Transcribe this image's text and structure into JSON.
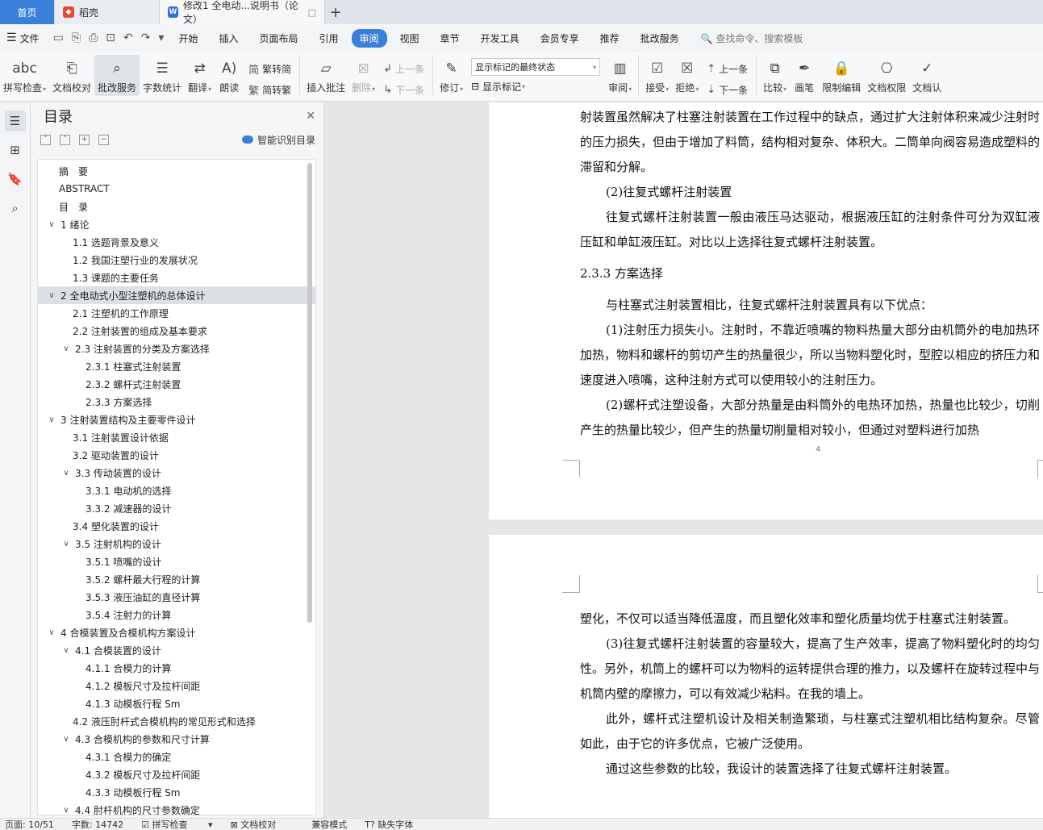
{
  "tabs": {
    "home": "首页",
    "daoke": "稻壳",
    "doc": "修改1 全电动...说明书（论文）"
  },
  "menu": {
    "file": "文件",
    "items": [
      "开始",
      "插入",
      "页面布局",
      "引用",
      "审阅",
      "视图",
      "章节",
      "开发工具",
      "会员专享",
      "推荐",
      "批改服务"
    ],
    "search": "查找命令、搜索模板"
  },
  "ribbon": {
    "spell": "拼写检查",
    "proof": "文档校对",
    "grading": "批改服务",
    "wordcount": "字数统计",
    "translate": "翻译",
    "read": "朗读",
    "trad": "繁转简",
    "simp": "简转繁",
    "insert_comment": "插入批注",
    "delete": "删除",
    "prev": "上一条",
    "next": "下一条",
    "revise": "修订",
    "markup_state": "显示标记的最终状态",
    "show_markup": "显示标记",
    "review": "审阅",
    "accept": "接受",
    "reject": "拒绝",
    "prev2": "上一条",
    "next2": "下一条",
    "compare": "比较",
    "pen": "画笔",
    "restrict": "限制编辑",
    "perm": "文档权限",
    "cert": "文档认"
  },
  "toc": {
    "title": "目录",
    "smart": "智能识别目录",
    "items": [
      {
        "text": "摘　要",
        "level": "lvl0",
        "chev": ""
      },
      {
        "text": "ABSTRACT",
        "level": "lvl0",
        "chev": ""
      },
      {
        "text": "目　录",
        "level": "lvl0",
        "chev": ""
      },
      {
        "text": "1  绪论",
        "level": "lvl1",
        "chev": "∨"
      },
      {
        "text": "1.1  选题背景及意义",
        "level": "lvl2",
        "chev": ""
      },
      {
        "text": "1.2  我国注塑行业的发展状况",
        "level": "lvl2",
        "chev": ""
      },
      {
        "text": "1.3  课题的主要任务",
        "level": "lvl2",
        "chev": ""
      },
      {
        "text": "2  全电动式小型注塑机的总体设计",
        "level": "lvl1 sel",
        "chev": "∨"
      },
      {
        "text": "2.1 注塑机的工作原理",
        "level": "lvl2",
        "chev": ""
      },
      {
        "text": "2.2  注射装置的组成及基本要求",
        "level": "lvl2",
        "chev": ""
      },
      {
        "text": "2.3  注射装置的分类及方案选择",
        "level": "lvl2c",
        "chev": "∨"
      },
      {
        "text": "2.3.1 柱塞式注射装置",
        "level": "lvl3",
        "chev": ""
      },
      {
        "text": "2.3.2 螺杆式注射装置",
        "level": "lvl3",
        "chev": ""
      },
      {
        "text": "2.3.3  方案选择",
        "level": "lvl3",
        "chev": ""
      },
      {
        "text": "3  注射装置结构及主要零件设计",
        "level": "lvl1",
        "chev": "∨"
      },
      {
        "text": "3.1 注射装置设计依据",
        "level": "lvl2",
        "chev": ""
      },
      {
        "text": "3.2  驱动装置的设计",
        "level": "lvl2",
        "chev": ""
      },
      {
        "text": "3.3 传动装置的设计",
        "level": "lvl2c",
        "chev": "∨"
      },
      {
        "text": "3.3.1 电动机的选择",
        "level": "lvl3",
        "chev": ""
      },
      {
        "text": "3.3.2 减速器的设计",
        "level": "lvl3",
        "chev": ""
      },
      {
        "text": "3.4 塑化装置的设计",
        "level": "lvl2",
        "chev": ""
      },
      {
        "text": "3.5 注射机构的设计",
        "level": "lvl2c",
        "chev": "∨"
      },
      {
        "text": "3.5.1 喷嘴的设计",
        "level": "lvl3",
        "chev": ""
      },
      {
        "text": "3.5.2  螺杆最大行程的计算",
        "level": "lvl3",
        "chev": ""
      },
      {
        "text": "3.5.3 液压油缸的直径计算",
        "level": "lvl3",
        "chev": ""
      },
      {
        "text": "3.5.4 注射力的计算",
        "level": "lvl3",
        "chev": ""
      },
      {
        "text": "4  合模装置及合模机构方案设计",
        "level": "lvl1",
        "chev": "∨"
      },
      {
        "text": "4.1  合模装置的设计",
        "level": "lvl2c",
        "chev": "∨"
      },
      {
        "text": "4.1.1 合模力的计算",
        "level": "lvl3",
        "chev": ""
      },
      {
        "text": "4.1.2 模板尺寸及拉杆间距",
        "level": "lvl3",
        "chev": ""
      },
      {
        "text": "4.1.3 动模板行程 Sm",
        "level": "lvl3",
        "chev": ""
      },
      {
        "text": "4.2  液压肘杆式合模机构的常见形式和选择",
        "level": "lvl2",
        "chev": ""
      },
      {
        "text": "4.3 合模机构的参数和尺寸计算",
        "level": "lvl2c",
        "chev": "∨"
      },
      {
        "text": "4.3.1 合模力的确定",
        "level": "lvl3",
        "chev": ""
      },
      {
        "text": "4.3.2  模板尺寸及拉杆间距",
        "level": "lvl3",
        "chev": ""
      },
      {
        "text": "4.3.3  动模板行程 Sm",
        "level": "lvl3",
        "chev": ""
      },
      {
        "text": "4.4  肘杆机构的尺寸参数确定",
        "level": "lvl2c",
        "chev": "∨"
      }
    ]
  },
  "doc": {
    "p1_lines": [
      "射装置虽然解决了柱塞注射装置在工作过程中的缺点，通过扩大注射体积来减少注射时的压力损失，但由于增加了料筒，结构相对复杂、体积大。二筒单向阀容易造成塑料的滞留和分解。"
    ],
    "p1_b": "(2)往复式螺杆注射装置",
    "p1_c": "往复式螺杆注射装置一般由液压马达驱动，根据液压缸的注射条件可分为双缸液压缸和单缸液压缸。对比以上选择往复式螺杆注射装置。",
    "heading": "2.3.3  方案选择",
    "p1_d": "与柱塞式注射装置相比，往复式螺杆注射装置具有以下优点：",
    "p1_e": "(1)注射压力损失小。注射时，不靠近喷嘴的物料热量大部分由机筒外的电加热环加热，物料和螺杆的剪切产生的热量很少，所以当物料塑化时，型腔以相应的挤压力和速度进入喷嘴，这种注射方式可以使用较小的注射压力。",
    "p1_f": "(2)螺杆式注塑设备，大部分热量是由料筒外的电热环加热，热量也比较少，切削产生的热量比较少，但产生的热量切削量相对较小，但通过对塑料进行加热",
    "page_num": "4",
    "p2_a": "塑化，不仅可以适当降低温度，而且塑化效率和塑化质量均优于柱塞式注射装置。",
    "p2_b": "(3)往复式螺杆注射装置的容量较大，提高了生产效率，提高了物料塑化时的均匀性。另外，机筒上的螺杆可以为物料的运转提供合理的推力，以及螺杆在旋转过程中与机筒内壁的摩擦力，可以有效减少粘料。在我的墙上。",
    "p2_c": "此外，螺杆式注塑机设计及相关制造繁琐，与柱塞式注塑机相比结构复杂。尽管如此，由于它的许多优点，它被广泛使用。",
    "p2_d": "通过这些参数的比较，我设计的装置选择了往复式螺杆注射装置。"
  },
  "status": {
    "page": "页面: 10/51",
    "words": "字数: 14742",
    "spell": "拼写检查",
    "proof": "文档校对",
    "compat": "兼容模式",
    "font": "缺失字体"
  }
}
